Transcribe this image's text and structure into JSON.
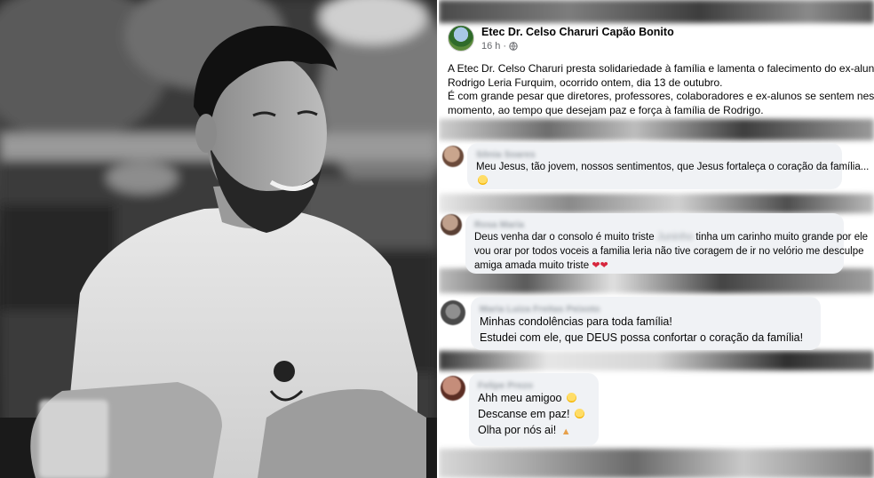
{
  "post": {
    "page_name": "Etec Dr. Celso Charuri Capão Bonito",
    "time": "16 h",
    "time_separator": "·",
    "body_lines": [
      "A Etec Dr. Celso Charuri presta solidariedade à família e lamenta o falecimento do ex-aluno,",
      "Rodrigo Leria Furquim, ocorrido ontem, dia 13 de outubro.",
      "É com grande pesar que diretores, professores,  colaboradores e ex-alunos se sentem neste",
      "momento, ao tempo que desejam paz e força à família de Rodrigo."
    ]
  },
  "comments": [
    {
      "author": "Sônia Soares",
      "lines": [
        "Meu Jesus, tão jovem, nossos sentimentos, que Jesus fortaleça o coração da família..."
      ],
      "emoji": "sad-face-icon"
    },
    {
      "author": "Rosa Maria",
      "line1_before": "Deus venha dar o consolo é muito triste",
      "line1_redacted": "Juninho",
      "line1_after": "tinha um carinho muito grande por ele",
      "lines": [
        "vou orar por todos voceis a familia leria não tive coragem de ir no velório me desculpe",
        "amiga amada muito triste"
      ],
      "emoji": "broken-heart-icon"
    },
    {
      "author": "Maria Luiza Freitas Peixoto",
      "lines": [
        "Minhas condolências para toda família!",
        "Estudei com ele, que DEUS possa confortar o coração da família!"
      ]
    },
    {
      "author": "Felipe Prezo",
      "lines": [
        "Ahh meu amigoo",
        "Descanse em paz!",
        "Olha por nós ai!"
      ],
      "emojis": [
        "crying-face-icon",
        "sad-face-icon",
        "praying-hands-icon"
      ]
    }
  ]
}
